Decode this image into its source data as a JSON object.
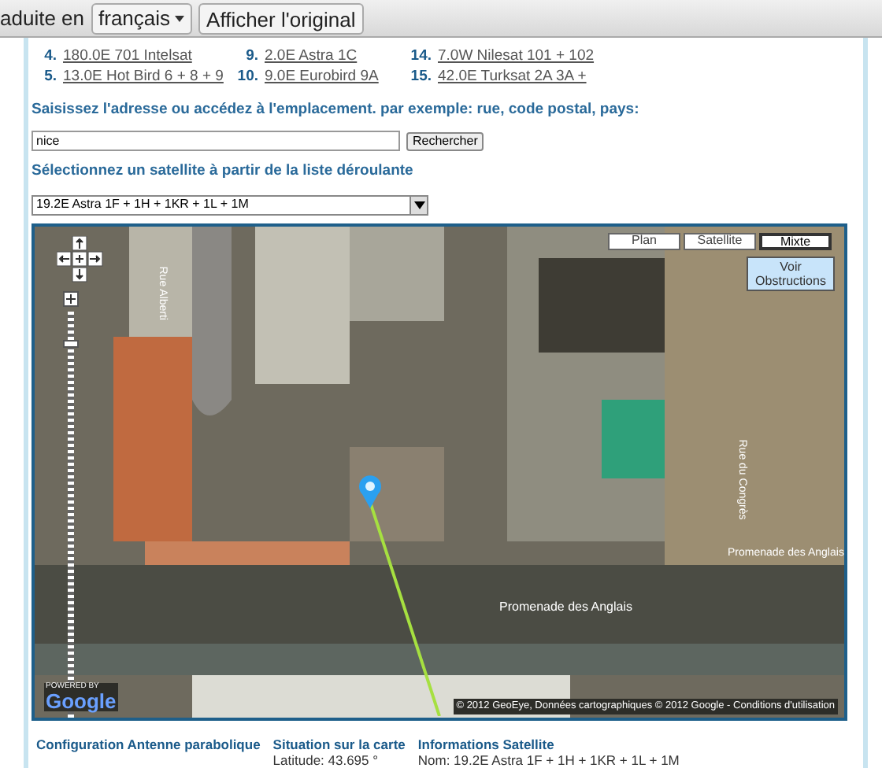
{
  "translate_bar": {
    "label": "aduite en",
    "language": "français",
    "button": "Afficher l'original"
  },
  "satellites": [
    {
      "number": "4.",
      "name": "180.0E 701 Intelsat"
    },
    {
      "number": "9.",
      "name": "2.0E Astra 1C"
    },
    {
      "number": "14.",
      "name": "7.0W Nilesat 101 + 102"
    },
    {
      "number": "5.",
      "name": "13.0E Hot Bird 6 + 8 + 9"
    },
    {
      "number": "10.",
      "name": "9.0E Eurobird 9A"
    },
    {
      "number": "15.",
      "name": "42.0E Turksat 2A 3A +"
    }
  ],
  "address_prompt": "Saisissez l'adresse ou accédez à l'emplacement. par exemple: rue, code postal, pays:",
  "address_field": {
    "value": "nice",
    "button": "Rechercher"
  },
  "satellite_prompt": "Sélectionnez un satellite à partir de la liste déroulante",
  "satellite_select": "19.2E Astra 1F + 1H + 1KR + 1L + 1M",
  "map": {
    "map_types": [
      {
        "label": "Plan",
        "selected": false
      },
      {
        "label": "Satellite",
        "selected": false
      },
      {
        "label": "Mixte",
        "selected": true
      }
    ],
    "obstructions_button": "Voir Obstructions",
    "zoom_slider": {
      "level": 0.93
    },
    "street_labels": [
      "Rue Alberti",
      "Rue du Congrès",
      "Promenade des Anglais",
      "Promenade des Anglais"
    ],
    "logo": {
      "small": "POWERED BY",
      "big": "Google"
    },
    "attribution": "© 2012 GeoEye, Données cartographiques © 2012 Google - Conditions d'utilisation"
  },
  "info_sections": [
    {
      "title": "Configuration Antenne parabolique"
    },
    {
      "title": "Situation sur la carte",
      "lines": [
        "Latitude: 43.695 °"
      ]
    },
    {
      "title": "Informations Satellite",
      "lines": [
        "Nom: 19.2E Astra 1F + 1H + 1KR + 1L + 1M"
      ]
    }
  ]
}
